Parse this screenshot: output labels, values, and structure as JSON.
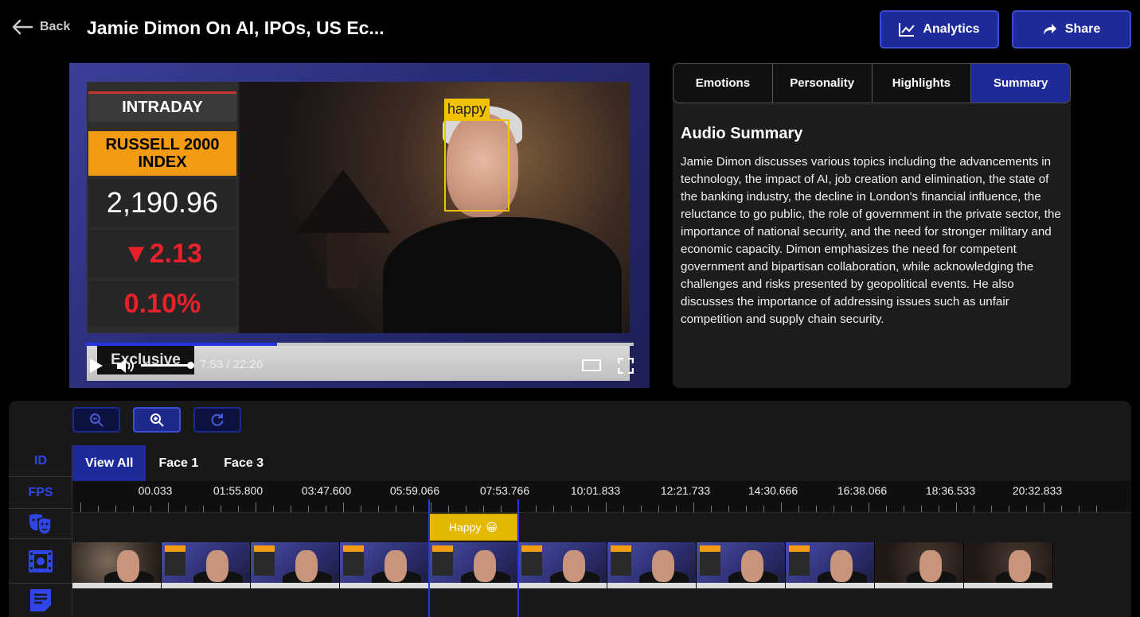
{
  "header": {
    "back_label": "Back",
    "title": "Jamie Dimon On AI, IPOs, US Ec...",
    "analytics_label": "Analytics",
    "share_label": "Share"
  },
  "video": {
    "ticker": {
      "label": "INTRADAY",
      "index_line1": "RUSSELL 2000",
      "index_line2": "INDEX",
      "value": "2,190.96",
      "change": "▼2.13",
      "percent": "0.10%"
    },
    "face_label": "happy",
    "lower_third": "Exclusive",
    "time_display": "7:53 / 22:26",
    "progress": 0.35,
    "volume": 0.9
  },
  "panel": {
    "tabs": [
      "Emotions",
      "Personality",
      "Highlights",
      "Summary"
    ],
    "active_tab": "Summary",
    "summary_title": "Audio Summary",
    "summary_text": "Jamie Dimon discusses various topics including the advancements in technology, the impact of AI, job creation and elimination, the state of the banking industry, the decline in London's financial influence, the reluctance to go public, the role of government in the private sector, the importance of national security, and the need for stronger military and economic capacity. Dimon emphasizes the need for competent government and bipartisan collaboration, while acknowledging the challenges and risks presented by geopolitical events. He also discusses the importance of addressing issues such as unfair competition and supply chain security."
  },
  "timeline": {
    "left_labels": {
      "id": "ID",
      "fps": "FPS"
    },
    "face_tabs": [
      "View All",
      "Face 1",
      "Face 3"
    ],
    "active_face_tab": "View All",
    "ruler_labels": [
      "00.033",
      "01:55.800",
      "03:47.600",
      "05:59.066",
      "07:53.766",
      "10:01.833",
      "12:21.733",
      "14:30.666",
      "16:38.066",
      "18:36.533",
      "20:32.833"
    ],
    "emotion_block": {
      "label": "Happy",
      "emoji": "😀"
    },
    "thumbnail_count": 11
  },
  "icons": {
    "back": "arrow-left-icon",
    "analytics": "line-chart-icon",
    "share": "share-arrow-icon",
    "zoom_out": "zoom-out-icon",
    "zoom_in": "zoom-in-icon",
    "reset": "redo-icon",
    "emotions": "theater-masks-icon",
    "frames": "film-icon",
    "transcript": "document-icon"
  },
  "colors": {
    "accent": "#1e2a99",
    "accent_text": "#2f45e6",
    "face_box": "#f2c200",
    "ticker_orange": "#f39b12",
    "ticker_red": "#e8202a"
  }
}
